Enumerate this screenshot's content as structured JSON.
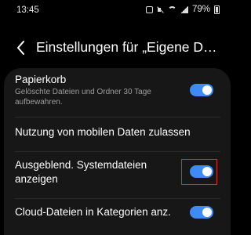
{
  "status_bar": {
    "time": "13:45",
    "battery": "79%",
    "icons": [
      "notification-box-icon",
      "mute-icon",
      "wifi-icon",
      "signal-icon",
      "battery-icon"
    ]
  },
  "header": {
    "title": "Einstellungen für „Eigene Dateien“"
  },
  "settings": [
    {
      "title": "Papierkorb",
      "subtitle": "Gelöschte Dateien und Ordner 30 Tage aufbewahren.",
      "toggle_on": true
    },
    {
      "title": "Nutzung von mobilen Daten zulassen"
    },
    {
      "title_line1": "Ausgeblend. Systemdateien",
      "title_line2": "anzeigen",
      "toggle_on": true,
      "highlighted": true
    },
    {
      "title": "Cloud-Dateien in Kategorien anz.",
      "toggle_on": true
    }
  ],
  "colors": {
    "background": "#000000",
    "card": "#171717",
    "toggle_on": "#3e8bf7",
    "highlight": "#d4302a"
  }
}
